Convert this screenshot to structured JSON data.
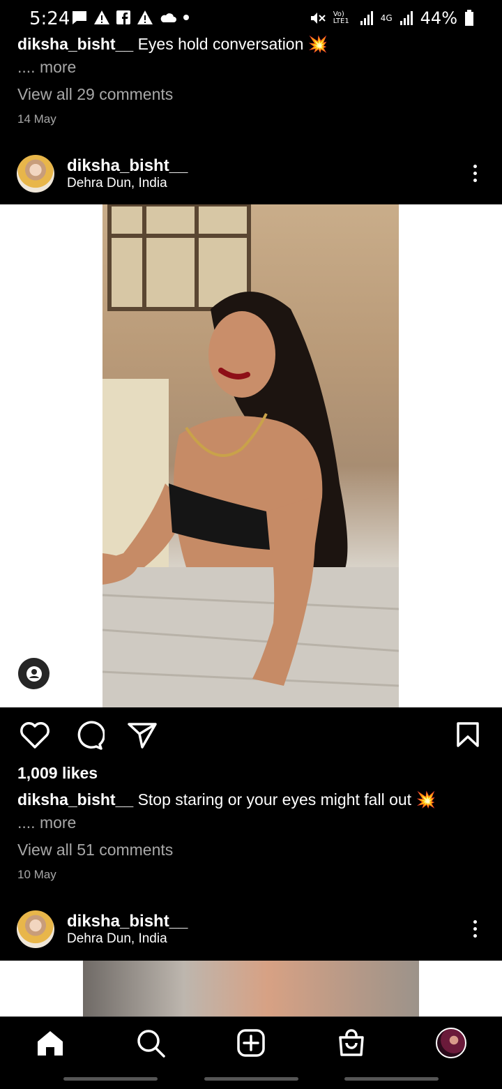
{
  "status_bar": {
    "time": "5:24",
    "network": "Vo) LTE1",
    "network2": "4G",
    "battery": "44%"
  },
  "previous_post": {
    "username": "diksha_bisht__",
    "caption": "Eyes hold conversation 💥",
    "more": ".... more",
    "view_comments": "View all 29 comments",
    "date": "14 May"
  },
  "post": {
    "username": "diksha_bisht__",
    "location": "Dehra Dun, India",
    "likes": "1,009 likes",
    "caption": "Stop staring or your eyes might fall out 💥",
    "more": ".... more",
    "view_comments": "View all 51 comments",
    "date": "10 May"
  },
  "next_post": {
    "username": "diksha_bisht__",
    "location": "Dehra Dun, India"
  },
  "nav": [
    "home-icon",
    "search-icon",
    "create-icon",
    "shop-icon",
    "profile-avatar"
  ]
}
